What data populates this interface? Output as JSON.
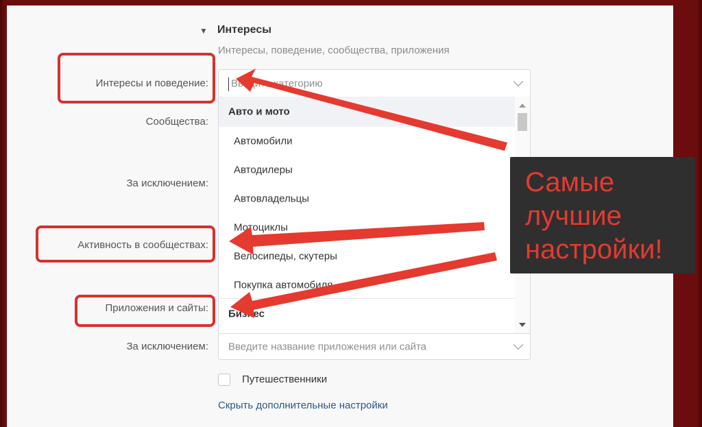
{
  "section": {
    "title": "Интересы",
    "subtitle": "Интересы, поведение, сообщества, приложения"
  },
  "labels": {
    "interests_behavior": "Интересы и поведение:",
    "communities": "Сообщества:",
    "except1": "За исключением:",
    "community_activity": "Активность в сообществах:",
    "apps_sites": "Приложения и сайты:",
    "except2": "За исключением:"
  },
  "inputs": {
    "category_placeholder": "Введите категорию",
    "app_placeholder": "Введите название приложения или сайта"
  },
  "dropdown": {
    "items": [
      {
        "label": "Авто и мото",
        "group": true
      },
      {
        "label": "Автомобили",
        "group": false
      },
      {
        "label": "Автодилеры",
        "group": false
      },
      {
        "label": "Автовладельцы",
        "group": false
      },
      {
        "label": "Мотоциклы",
        "group": false
      },
      {
        "label": "Велосипеды, скутеры",
        "group": false
      },
      {
        "label": "Покупка автомобиля",
        "group": false
      },
      {
        "label": "Бизнес",
        "group": true
      }
    ]
  },
  "checkbox": {
    "label": "Путешественники",
    "checked": false
  },
  "link": {
    "hide_settings": "Скрыть дополнительные настройки"
  },
  "callout": {
    "lines": [
      "Самые",
      "лучшие",
      "настройки!"
    ]
  },
  "colors": {
    "annotation_red": "#d9302c",
    "link_blue": "#2a5885"
  }
}
